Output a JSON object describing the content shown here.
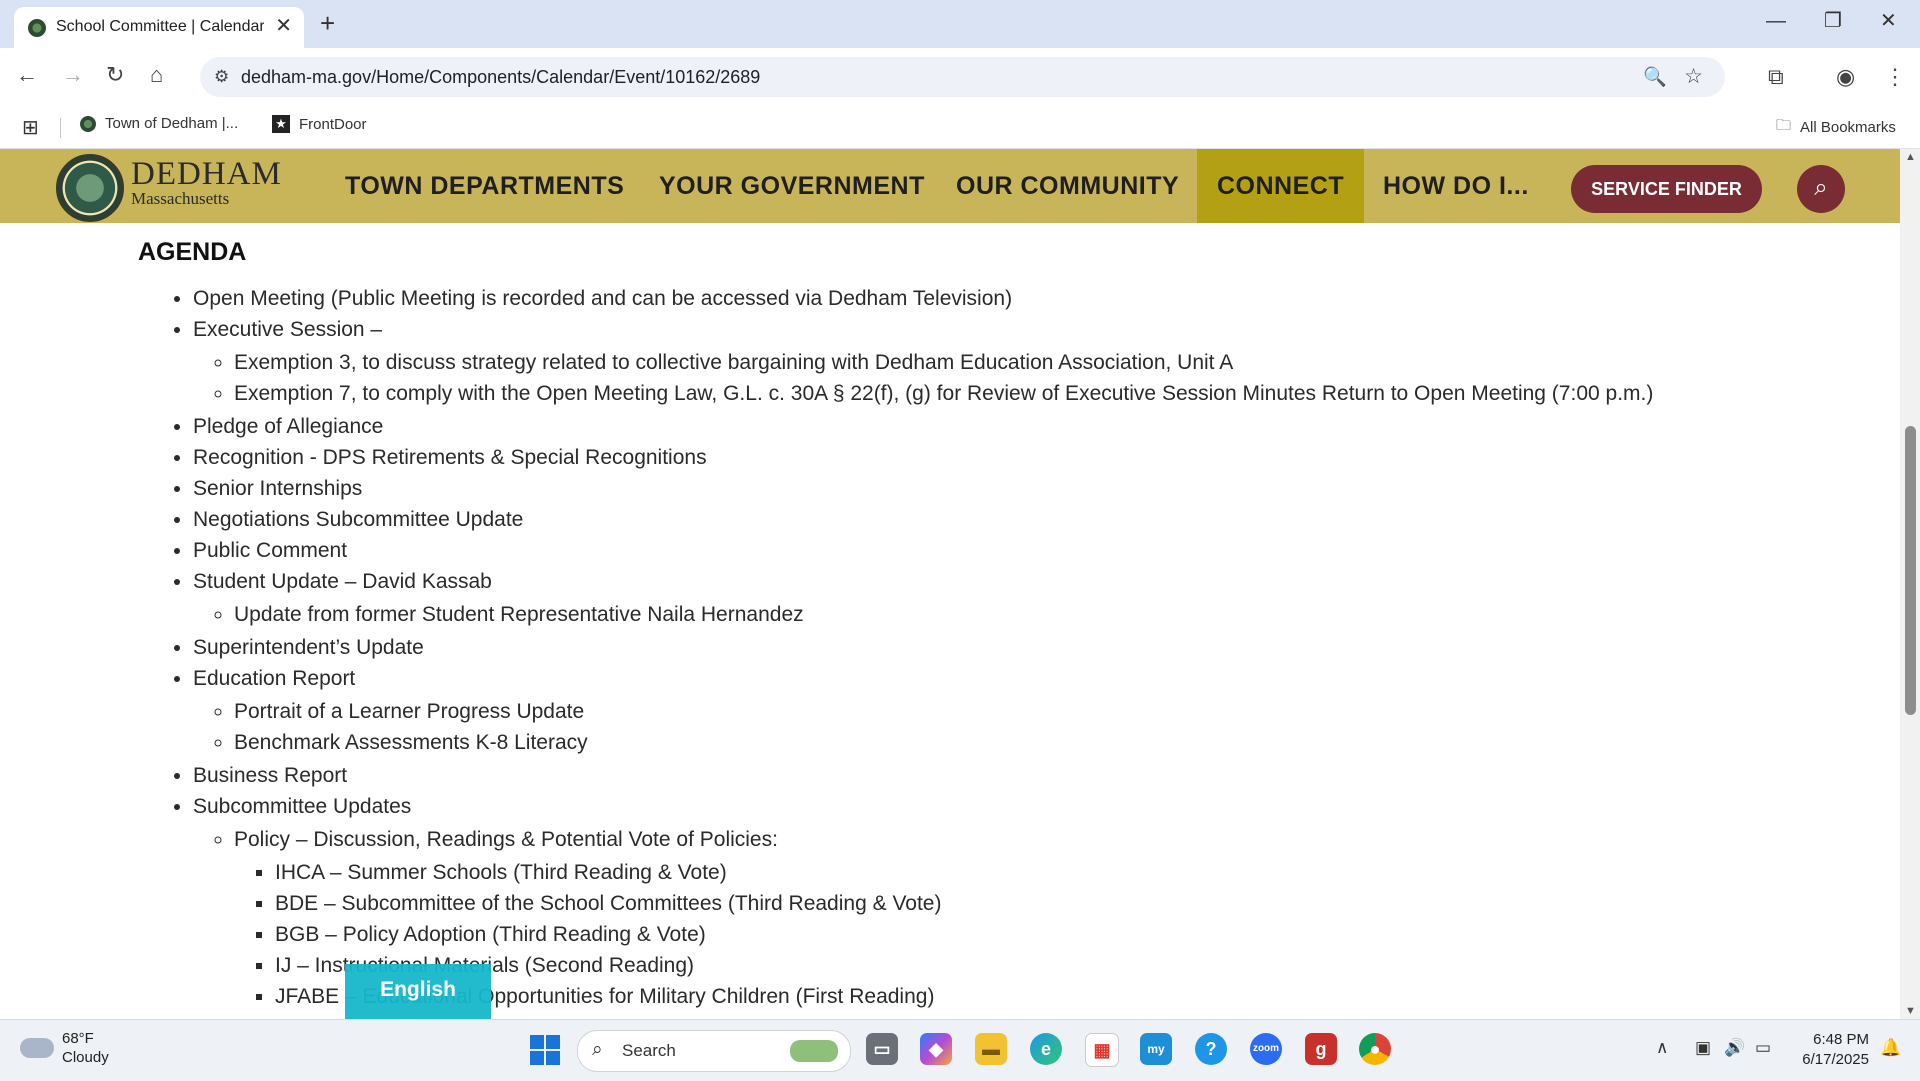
{
  "browser": {
    "tab_title": "School Committee | Calendar | Town",
    "url": "dedham-ma.gov/Home/Components/Calendar/Event/10162/2689",
    "bookmarks": [
      {
        "label": "Town of Dedham |..."
      },
      {
        "label": "FrontDoor"
      }
    ],
    "all_bookmarks_label": "All Bookmarks"
  },
  "site": {
    "logo_name": "DEDHAM",
    "logo_sub": "Massachusetts",
    "nav": [
      "TOWN DEPARTMENTS",
      "YOUR GOVERNMENT",
      "OUR COMMUNITY",
      "CONNECT",
      "HOW DO I..."
    ],
    "service_finder_label": "SERVICE FINDER",
    "colors": {
      "header": "#c9b559",
      "active_nav": "#b4a013",
      "button": "#7a2c35"
    }
  },
  "agenda": {
    "title": "AGENDA",
    "items": [
      "Open Meeting (Public Meeting is recorded and can be accessed via Dedham Television)",
      "Executive Session –",
      "Exemption 3, to discuss strategy related to collective bargaining with Dedham Education Association, Unit A",
      "Exemption 7, to comply with the Open Meeting Law, G.L. c. 30A § 22(f), (g) for Review of Executive Session Minutes Return to Open Meeting (7:00 p.m.)",
      "Pledge of Allegiance",
      "Recognition - DPS Retirements & Special Recognitions",
      "Senior Internships",
      "Negotiations Subcommittee Update",
      "Public Comment",
      "Student Update – David Kassab",
      "Update from former Student Representative Naila Hernandez",
      "Superintendent’s Update",
      "Education Report",
      "Portrait of a Learner Progress Update",
      "Benchmark Assessments K-8 Literacy",
      "Business Report",
      "Subcommittee Updates",
      "Policy – Discussion, Readings & Potential Vote of Policies:",
      "IHCA – Summer Schools (Third Reading & Vote)",
      "BDE – Subcommittee of the School Committees (Third Reading & Vote)",
      "BGB – Policy Adoption (Third Reading & Vote)",
      "IJ – Instructional Materials (Second Reading)",
      "JFABE – Educational Opportunities for Military Children (First Reading)"
    ]
  },
  "translate_label": "English",
  "taskbar": {
    "weather_temp": "68°F",
    "weather_desc": "Cloudy",
    "search_label": "Search",
    "time": "6:48 PM",
    "date": "6/17/2025"
  }
}
